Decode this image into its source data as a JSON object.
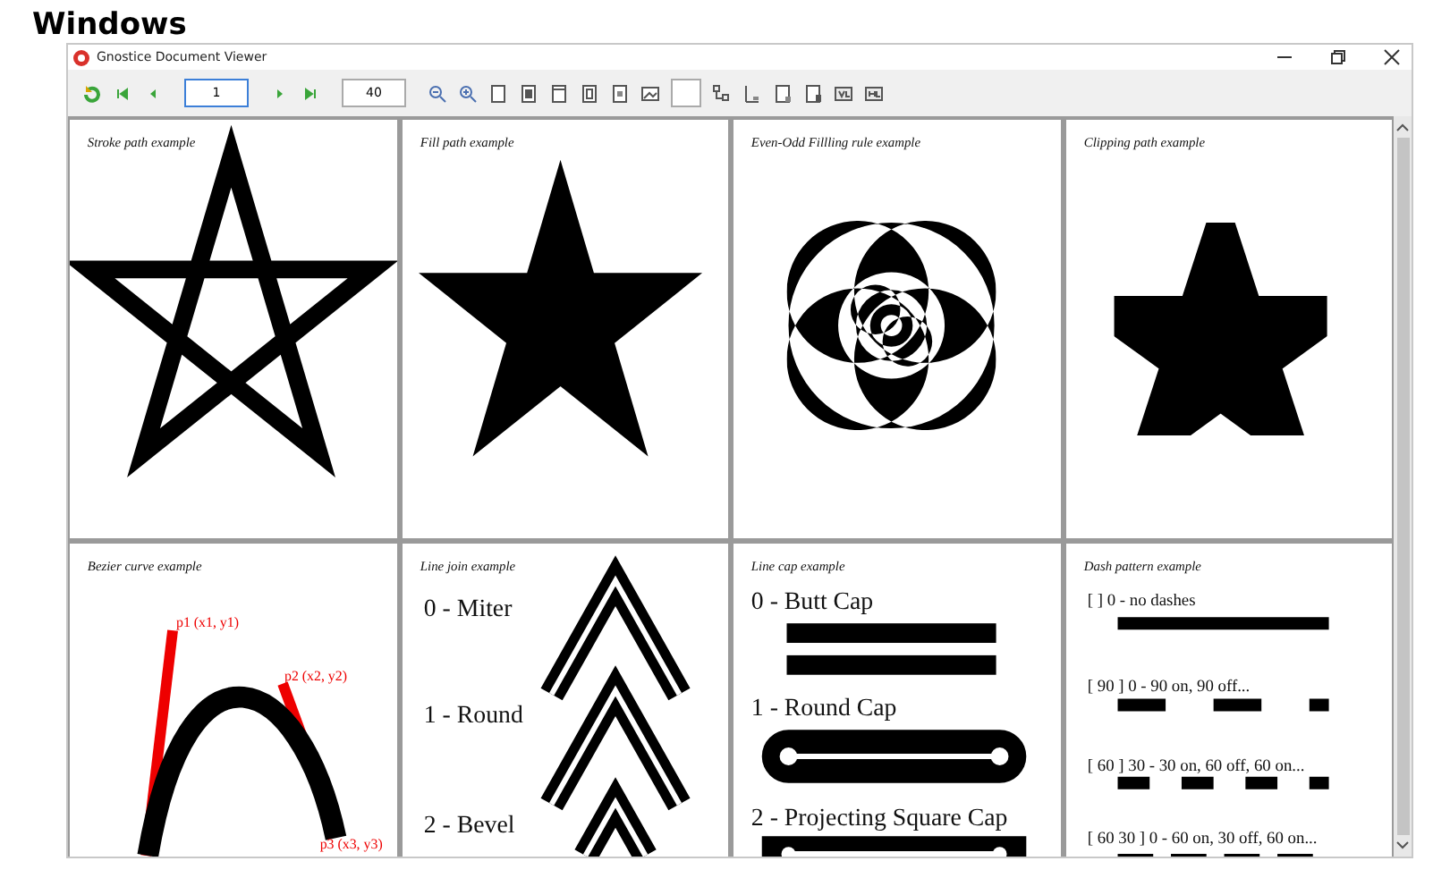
{
  "heading": "Windows",
  "window": {
    "title": "Gnostice Document Viewer"
  },
  "toolbar": {
    "page": "1",
    "zoom": "40"
  },
  "panels": [
    {
      "kind": "stroke",
      "title": "Stroke path example"
    },
    {
      "kind": "fill",
      "title": "Fill path example"
    },
    {
      "kind": "evenodd",
      "title": "Even-Odd Fillling rule example"
    },
    {
      "kind": "clip",
      "title": "Clipping path example"
    },
    {
      "kind": "bezier",
      "title": "Bezier curve example",
      "labels": [
        "p1 (x1, y1)",
        "p2 (x2, y2)",
        "p3 (x3, y3)"
      ]
    },
    {
      "kind": "join",
      "title": "Line join example",
      "labels": [
        "0 - Miter",
        "1 - Round",
        "2 - Bevel"
      ]
    },
    {
      "kind": "cap",
      "title": "Line cap example",
      "labels": [
        "0 - Butt Cap",
        "1 - Round Cap",
        "2 - Projecting Square Cap"
      ]
    },
    {
      "kind": "dash",
      "title": "Dash pattern example",
      "labels": [
        "[ ] 0 - no dashes",
        "[ 90 ] 0 - 90 on, 90 off...",
        "[ 60 ] 30 - 30 on, 60 off, 60 on...",
        "[ 60 30 ] 0 - 60 on, 30 off, 60 on..."
      ]
    }
  ]
}
